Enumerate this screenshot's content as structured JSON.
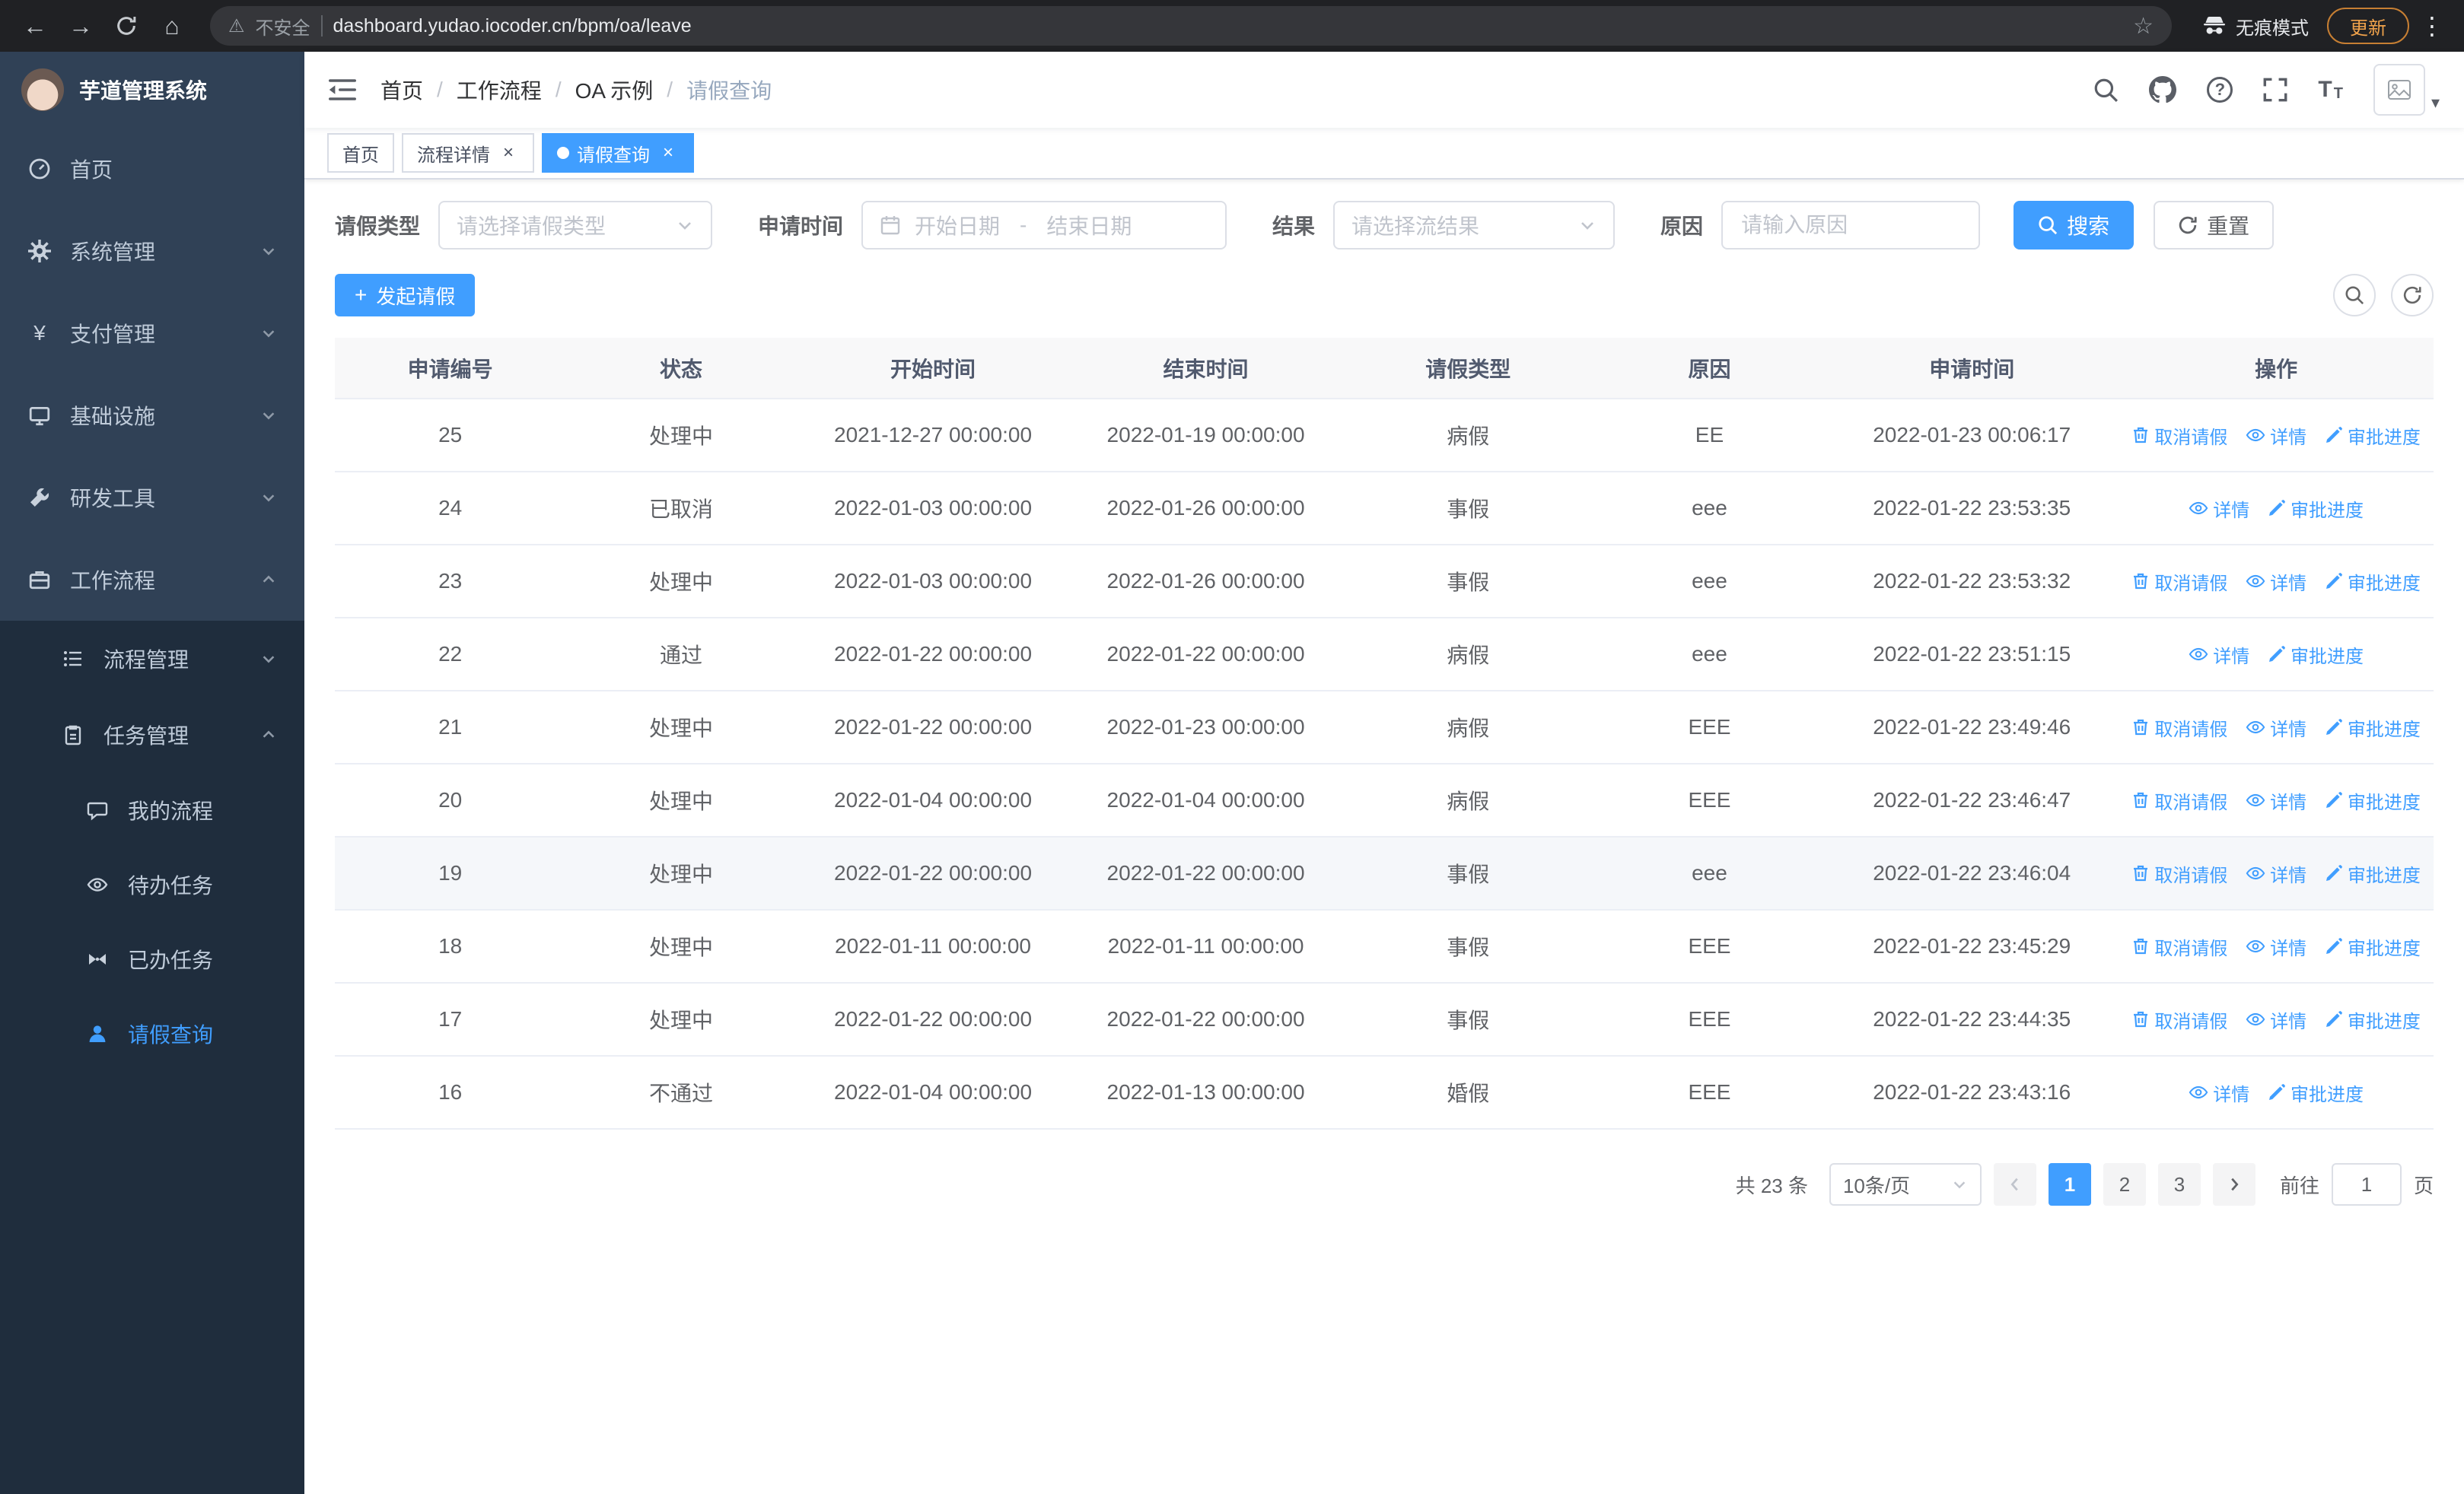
{
  "browser": {
    "security_label": "不安全",
    "url": "dashboard.yudao.iocoder.cn/bpm/oa/leave",
    "incognito_label": "无痕模式",
    "update_label": "更新"
  },
  "icons": {
    "back": "←",
    "forward": "→",
    "home": "⌂",
    "warning": "⚠",
    "star": "☆",
    "menu_dots": "⋮",
    "yen": "¥",
    "plus": "+",
    "question": "?",
    "close": "×",
    "caret_down": "▾"
  },
  "sidebar": {
    "logo_title": "芋道管理系统",
    "items": [
      {
        "label": "首页"
      },
      {
        "label": "系统管理"
      },
      {
        "label": "支付管理"
      },
      {
        "label": "基础设施"
      },
      {
        "label": "研发工具"
      },
      {
        "label": "工作流程"
      }
    ],
    "workflow_children": [
      {
        "label": "流程管理"
      },
      {
        "label": "任务管理"
      }
    ],
    "task_children": [
      {
        "label": "我的流程"
      },
      {
        "label": "待办任务"
      },
      {
        "label": "已办任务"
      },
      {
        "label": "请假查询"
      }
    ]
  },
  "header": {
    "breadcrumb": [
      "首页",
      "工作流程",
      "OA 示例",
      "请假查询"
    ]
  },
  "tabs": [
    {
      "label": "首页"
    },
    {
      "label": "流程详情"
    },
    {
      "label": "请假查询"
    }
  ],
  "filters": {
    "leave_type_label": "请假类型",
    "leave_type_placeholder": "请选择请假类型",
    "apply_time_label": "申请时间",
    "start_date_placeholder": "开始日期",
    "range_separator": "-",
    "end_date_placeholder": "结束日期",
    "result_label": "结果",
    "result_placeholder": "请选择流结果",
    "reason_label": "原因",
    "reason_placeholder": "请输入原因",
    "search_label": "搜索",
    "reset_label": "重置"
  },
  "toolbar": {
    "create_label": "发起请假"
  },
  "table": {
    "columns": [
      "申请编号",
      "状态",
      "开始时间",
      "结束时间",
      "请假类型",
      "原因",
      "申请时间",
      "操作"
    ],
    "action_labels": {
      "cancel": "取消请假",
      "detail": "详情",
      "progress": "审批进度"
    },
    "rows": [
      {
        "id": "25",
        "status": "处理中",
        "start": "2021-12-27 00:00:00",
        "end": "2022-01-19 00:00:00",
        "type": "病假",
        "reason": "EE",
        "apply_time": "2022-01-23 00:06:17",
        "cancelable": true
      },
      {
        "id": "24",
        "status": "已取消",
        "start": "2022-01-03 00:00:00",
        "end": "2022-01-26 00:00:00",
        "type": "事假",
        "reason": "eee",
        "apply_time": "2022-01-22 23:53:35",
        "cancelable": false
      },
      {
        "id": "23",
        "status": "处理中",
        "start": "2022-01-03 00:00:00",
        "end": "2022-01-26 00:00:00",
        "type": "事假",
        "reason": "eee",
        "apply_time": "2022-01-22 23:53:32",
        "cancelable": true
      },
      {
        "id": "22",
        "status": "通过",
        "start": "2022-01-22 00:00:00",
        "end": "2022-01-22 00:00:00",
        "type": "病假",
        "reason": "eee",
        "apply_time": "2022-01-22 23:51:15",
        "cancelable": false
      },
      {
        "id": "21",
        "status": "处理中",
        "start": "2022-01-22 00:00:00",
        "end": "2022-01-23 00:00:00",
        "type": "病假",
        "reason": "EEE",
        "apply_time": "2022-01-22 23:49:46",
        "cancelable": true
      },
      {
        "id": "20",
        "status": "处理中",
        "start": "2022-01-04 00:00:00",
        "end": "2022-01-04 00:00:00",
        "type": "病假",
        "reason": "EEE",
        "apply_time": "2022-01-22 23:46:47",
        "cancelable": true
      },
      {
        "id": "19",
        "status": "处理中",
        "start": "2022-01-22 00:00:00",
        "end": "2022-01-22 00:00:00",
        "type": "事假",
        "reason": "eee",
        "apply_time": "2022-01-22 23:46:04",
        "cancelable": true,
        "highlight": true
      },
      {
        "id": "18",
        "status": "处理中",
        "start": "2022-01-11 00:00:00",
        "end": "2022-01-11 00:00:00",
        "type": "事假",
        "reason": "EEE",
        "apply_time": "2022-01-22 23:45:29",
        "cancelable": true
      },
      {
        "id": "17",
        "status": "处理中",
        "start": "2022-01-22 00:00:00",
        "end": "2022-01-22 00:00:00",
        "type": "事假",
        "reason": "EEE",
        "apply_time": "2022-01-22 23:44:35",
        "cancelable": true
      },
      {
        "id": "16",
        "status": "不通过",
        "start": "2022-01-04 00:00:00",
        "end": "2022-01-13 00:00:00",
        "type": "婚假",
        "reason": "EEE",
        "apply_time": "2022-01-22 23:43:16",
        "cancelable": false
      }
    ]
  },
  "pagination": {
    "total_label": "共 23 条",
    "page_size": "10条/页",
    "pages": [
      "1",
      "2",
      "3"
    ],
    "goto_label": "前往",
    "goto_value": "1",
    "page_suffix": "页"
  },
  "colors": {
    "accent": "#409EFF"
  }
}
